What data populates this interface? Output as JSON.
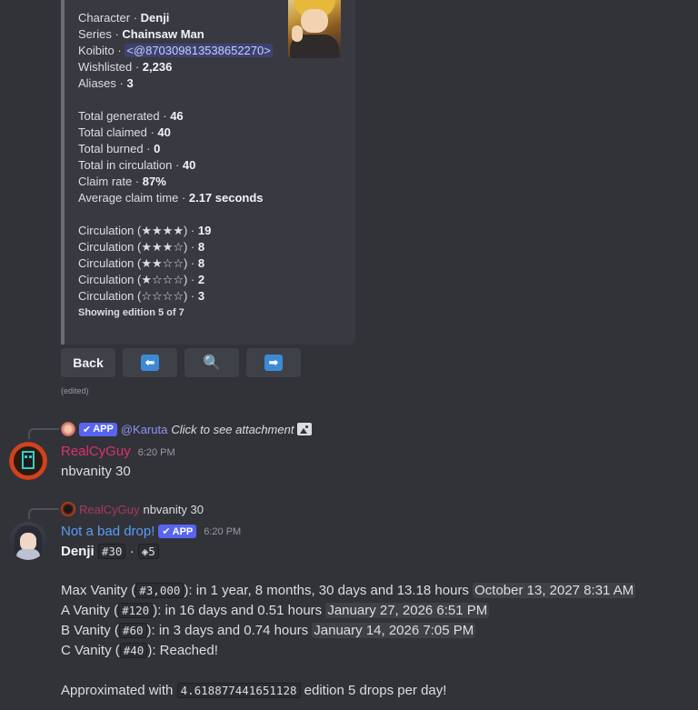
{
  "embed": {
    "rows": [
      {
        "label": "Character · ",
        "value": "Denji"
      },
      {
        "label": "Series · ",
        "value": "Chainsaw Man"
      },
      {
        "label": "Koibito · ",
        "mention": "<@870309813538652270>"
      },
      {
        "label": "Wishlisted · ",
        "value": "2,236"
      },
      {
        "label": "Aliases · ",
        "value": "3"
      },
      {
        "label": "Total generated · ",
        "value": "46"
      },
      {
        "label": "Total claimed · ",
        "value": "40"
      },
      {
        "label": "Total burned · ",
        "value": "0"
      },
      {
        "label": "Total in circulation · ",
        "value": "40"
      },
      {
        "label": "Claim rate · ",
        "value": "87%"
      },
      {
        "label": "Average claim time · ",
        "value": "2.17 seconds"
      },
      {
        "label": "Circulation (★★★★) · ",
        "value": "19"
      },
      {
        "label": "Circulation (★★★☆) · ",
        "value": "8"
      },
      {
        "label": "Circulation (★★☆☆) · ",
        "value": "8"
      },
      {
        "label": "Circulation (★☆☆☆) · ",
        "value": "2"
      },
      {
        "label": "Circulation (☆☆☆☆) · ",
        "value": "3"
      }
    ],
    "footer": "Showing edition 5 of 7"
  },
  "buttons": {
    "back": "Back",
    "prev_icon": "left-arrow-icon",
    "search_icon": "magnifier-icon",
    "next_icon": "right-arrow-icon"
  },
  "edited": "(edited)",
  "message1": {
    "reply": {
      "badge": "APP",
      "author": "@Karuta",
      "text": "Click to see attachment",
      "icon": "image-icon"
    },
    "username": "RealCyGuy",
    "username_color": "#e0316c",
    "time": "6:20 PM",
    "content": "nbvanity 30"
  },
  "message2": {
    "reply": {
      "author": "RealCyGuy",
      "text": "nbvanity 30"
    },
    "username": "Not a bad drop!",
    "username_color": "#5b9bf5",
    "badge": "APP",
    "time": "6:20 PM",
    "title_name": "Denji",
    "title_code1": "#30",
    "title_sep": "·",
    "title_code2": "◈5",
    "lines": [
      {
        "pre": "Max Vanity (",
        "code": "#3,000",
        "post": "): in 1 year, 8 months, 30 days and 13.18 hours ",
        "date": "October 13, 2027 8:31 AM"
      },
      {
        "pre": "A Vanity (",
        "code": "#120",
        "post": "): in 16 days and 0.51 hours ",
        "date": "January 27, 2026 6:51 PM"
      },
      {
        "pre": "B Vanity (",
        "code": "#60",
        "post": "): in 3 days and 0.74 hours ",
        "date": "January 14, 2026 7:05 PM"
      },
      {
        "pre": "C Vanity (",
        "code": "#40",
        "post": "): Reached!",
        "date": ""
      }
    ],
    "approx_pre": "Approximated with ",
    "approx_code": "4.618877441651128",
    "approx_post": " edition 5 drops per day!"
  }
}
